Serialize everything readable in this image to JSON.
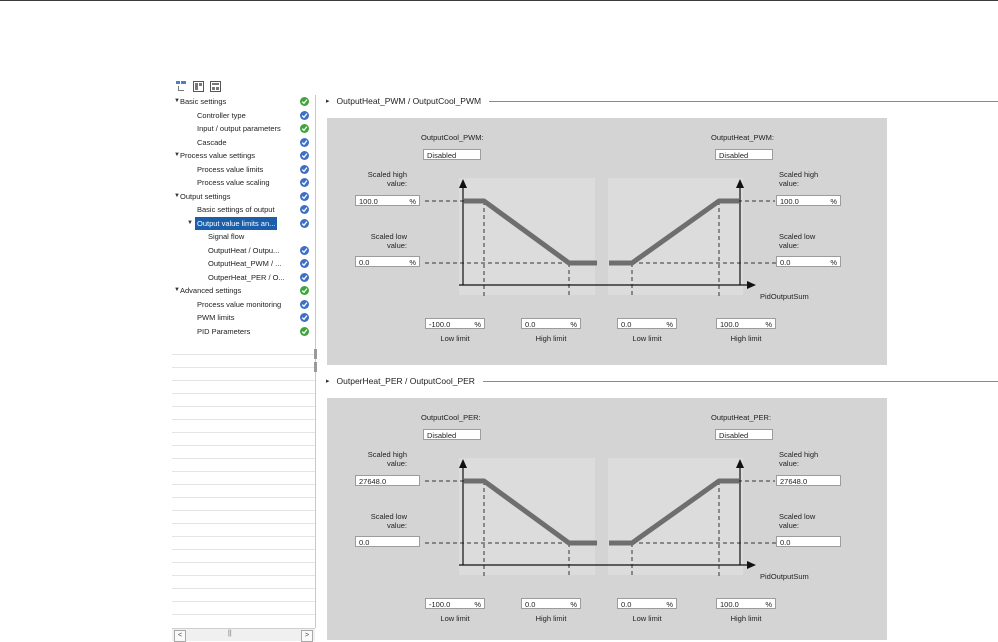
{
  "toolbar": {
    "icons": [
      "structure-view-icon",
      "split-view-icon",
      "function-view-icon"
    ]
  },
  "nav": {
    "items": [
      {
        "label": "Basic settings",
        "level": 0,
        "expanded": true,
        "status": "green"
      },
      {
        "label": "Controller type",
        "level": 1,
        "status": "blue"
      },
      {
        "label": "Input / output parameters",
        "level": 1,
        "status": "green"
      },
      {
        "label": "Cascade",
        "level": 1,
        "status": "blue"
      },
      {
        "label": "Process value settings",
        "level": 0,
        "expanded": true,
        "status": "blue"
      },
      {
        "label": "Process value limits",
        "level": 1,
        "status": "blue"
      },
      {
        "label": "Process value scaling",
        "level": 1,
        "status": "blue"
      },
      {
        "label": "Output settings",
        "level": 0,
        "expanded": true,
        "status": "blue"
      },
      {
        "label": "Basic settings of output",
        "level": 1,
        "status": "blue"
      },
      {
        "label": "Output value limits an...",
        "level": 1,
        "expanded": true,
        "selected": true,
        "status": "blue"
      },
      {
        "label": "Signal flow",
        "level": 2,
        "status": ""
      },
      {
        "label": "OutputHeat / Outpu...",
        "level": 2,
        "status": "blue"
      },
      {
        "label": "OutputHeat_PWM / ...",
        "level": 2,
        "status": "blue"
      },
      {
        "label": "OutperHeat_PER / O...",
        "level": 2,
        "status": "blue"
      },
      {
        "label": "Advanced settings",
        "level": 0,
        "expanded": true,
        "status": "green"
      },
      {
        "label": "Process value monitoring",
        "level": 1,
        "status": "blue"
      },
      {
        "label": "PWM limits",
        "level": 1,
        "status": "blue"
      },
      {
        "label": "PID Parameters",
        "level": 1,
        "status": "green"
      }
    ],
    "scroll_left": "<",
    "scroll_right": ">",
    "scroll_thumb": "||"
  },
  "sections": [
    {
      "title": "OutputHeat_PWM / OutputCool_PWM",
      "cool_label": "OutputCool_PWM:",
      "cool_value": "Disabled",
      "heat_label": "OutputHeat_PWM:",
      "heat_value": "Disabled",
      "scaled_high_label": "Scaled high value:",
      "scaled_low_label": "Scaled low value:",
      "left_high_value": "100.0",
      "left_low_value": "0.0",
      "right_high_value": "100.0",
      "right_low_value": "0.0",
      "unit": "%",
      "show_units": true,
      "axis_label": "PidOutputSum",
      "limits": [
        {
          "value": "-100.0",
          "unit": "%",
          "caption": "Low limit"
        },
        {
          "value": "0.0",
          "unit": "%",
          "caption": "High limit"
        },
        {
          "value": "0.0",
          "unit": "%",
          "caption": "Low limit"
        },
        {
          "value": "100.0",
          "unit": "%",
          "caption": "High limit"
        }
      ]
    },
    {
      "title": "OutperHeat_PER / OutputCool_PER",
      "cool_label": "OutputCool_PER:",
      "cool_value": "Disabled",
      "heat_label": "OutputHeat_PER:",
      "heat_value": "Disabled",
      "scaled_high_label": "Scaled high value:",
      "scaled_low_label": "Scaled low value:",
      "left_high_value": "27648.0",
      "left_low_value": "0.0",
      "right_high_value": "27648.0",
      "right_low_value": "0.0",
      "unit": "%",
      "show_units": false,
      "axis_label": "PidOutputSum",
      "limits": [
        {
          "value": "-100.0",
          "unit": "%",
          "caption": "Low limit"
        },
        {
          "value": "0.0",
          "unit": "%",
          "caption": "High limit"
        },
        {
          "value": "0.0",
          "unit": "%",
          "caption": "Low limit"
        },
        {
          "value": "100.0",
          "unit": "%",
          "caption": "High limit"
        }
      ]
    }
  ],
  "colors": {
    "panel": "#d4d4d4",
    "plot_area": "#dcdcdc",
    "curve": "#6e6e6e",
    "selected": "#1b5fab",
    "status_ok": "#3da43b",
    "status_info": "#3d6fc6"
  }
}
